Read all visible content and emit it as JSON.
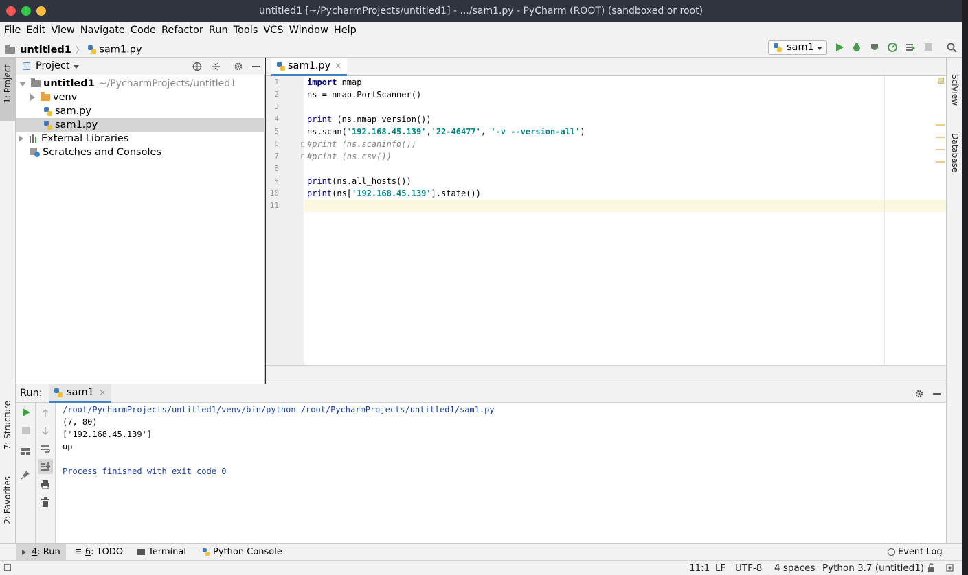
{
  "window": {
    "title": "untitled1 [~/PycharmProjects/untitled1] - .../sam1.py - PyCharm (ROOT) (sandboxed or root)",
    "traffic_colors": [
      "#fc5753",
      "#33c748",
      "#fdbc40"
    ]
  },
  "menu": {
    "items": [
      {
        "u": "F",
        "rest": "ile"
      },
      {
        "u": "E",
        "rest": "dit"
      },
      {
        "u": "V",
        "rest": "iew"
      },
      {
        "u": "N",
        "rest": "avigate"
      },
      {
        "u": "C",
        "rest": "ode"
      },
      {
        "u": "R",
        "rest": "efactor"
      },
      {
        "u": "",
        "rest": "Run"
      },
      {
        "u": "T",
        "rest": "ools"
      },
      {
        "u": "",
        "rest": "VCS"
      },
      {
        "u": "W",
        "rest": "indow"
      },
      {
        "u": "H",
        "rest": "elp"
      }
    ]
  },
  "breadcrumb": {
    "project": "untitled1",
    "file": "sam1.py"
  },
  "run_config": {
    "selected": "sam1"
  },
  "left_stripe": {
    "project": "1: Project",
    "structure": "7: Structure",
    "favorites": "2: Favorites"
  },
  "right_stripe": {
    "sciview": "SciView",
    "database": "Database"
  },
  "project_panel": {
    "title": "Project",
    "root_name": "untitled1",
    "root_path": "~/PycharmProjects/untitled1",
    "venv": "venv",
    "file1": "sam.py",
    "file2": "sam1.py",
    "ext_libs": "External Libraries",
    "scratches": "Scratches and Consoles"
  },
  "editor": {
    "tab": "sam1.py",
    "line_numbers": [
      "1",
      "2",
      "3",
      "4",
      "5",
      "6",
      "7",
      "8",
      "9",
      "10",
      "11"
    ],
    "current_line": 11
  },
  "run": {
    "label": "Run:",
    "tab": "sam1",
    "output": {
      "cmd": "/root/PycharmProjects/untitled1/venv/bin/python /root/PycharmProjects/untitled1/sam1.py",
      "line1": "(7, 80)",
      "line2": "['192.168.45.139']",
      "line3": "up",
      "exit": "Process finished with exit code 0"
    }
  },
  "bottom_tabs": {
    "run_num": "4",
    "run_rest": ": Run",
    "todo_num": "6",
    "todo_rest": ": TODO",
    "terminal": "Terminal",
    "python_console": "Python Console",
    "event_log": "Event Log"
  },
  "status": {
    "position": "11:1",
    "line_sep": "LF",
    "encoding": "UTF-8",
    "indent": "4 spaces",
    "interpreter": "Python 3.7 (untitled1)"
  },
  "colors": {
    "run_green": "#3fa33f",
    "debug_green": "#499c54",
    "selection": "#d5d5d5",
    "accent": "#4083c9"
  }
}
